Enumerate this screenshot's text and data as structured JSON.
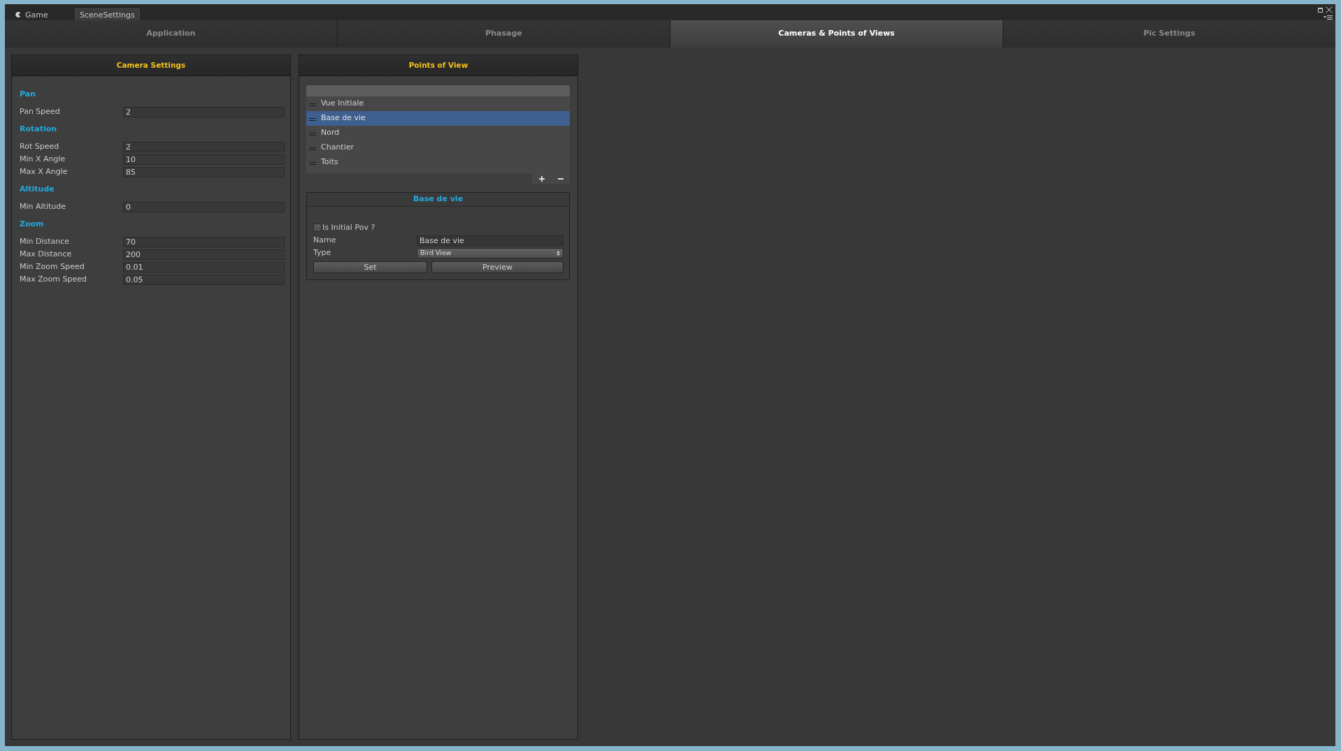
{
  "editor_tabs": [
    {
      "label": "Game",
      "kind": "game",
      "selected": false
    },
    {
      "label": "SceneSettings",
      "kind": "window",
      "selected": true
    }
  ],
  "tabs": [
    {
      "label": "Application",
      "selected": false
    },
    {
      "label": "Phasage",
      "selected": false
    },
    {
      "label": "Cameras & Points of Views",
      "selected": true
    },
    {
      "label": "Pic Settings",
      "selected": false
    }
  ],
  "camera_settings": {
    "title": "Camera Settings",
    "sections": [
      {
        "title": "Pan",
        "fields": [
          {
            "label": "Pan Speed",
            "value": "2"
          }
        ]
      },
      {
        "title": "Rotation",
        "fields": [
          {
            "label": "Rot Speed",
            "value": "2"
          },
          {
            "label": "Min X Angle",
            "value": "10"
          },
          {
            "label": "Max X Angle",
            "value": "85"
          }
        ]
      },
      {
        "title": "Altitude",
        "fields": [
          {
            "label": "Min Altitude",
            "value": "0"
          }
        ]
      },
      {
        "title": "Zoom",
        "fields": [
          {
            "label": "Min Distance",
            "value": "70"
          },
          {
            "label": "Max Distance",
            "value": "200"
          },
          {
            "label": "Min Zoom Speed",
            "value": "0.01"
          },
          {
            "label": "Max Zoom Speed",
            "value": "0.05"
          }
        ]
      }
    ]
  },
  "points_of_view": {
    "title": "Points of View",
    "items": [
      {
        "label": "Vue Initiale",
        "selected": false
      },
      {
        "label": "Base de vie",
        "selected": true
      },
      {
        "label": "Nord",
        "selected": false
      },
      {
        "label": "Chantier",
        "selected": false
      },
      {
        "label": "Toits",
        "selected": false
      }
    ],
    "detail": {
      "title": "Base de vie",
      "initial_pov": {
        "label": "Is Initial Pov ?",
        "checked": false
      },
      "name": {
        "label": "Name",
        "value": "Base de vie"
      },
      "type": {
        "label": "Type",
        "value": "Bird View"
      },
      "buttons": [
        "Set",
        "Preview"
      ]
    }
  }
}
